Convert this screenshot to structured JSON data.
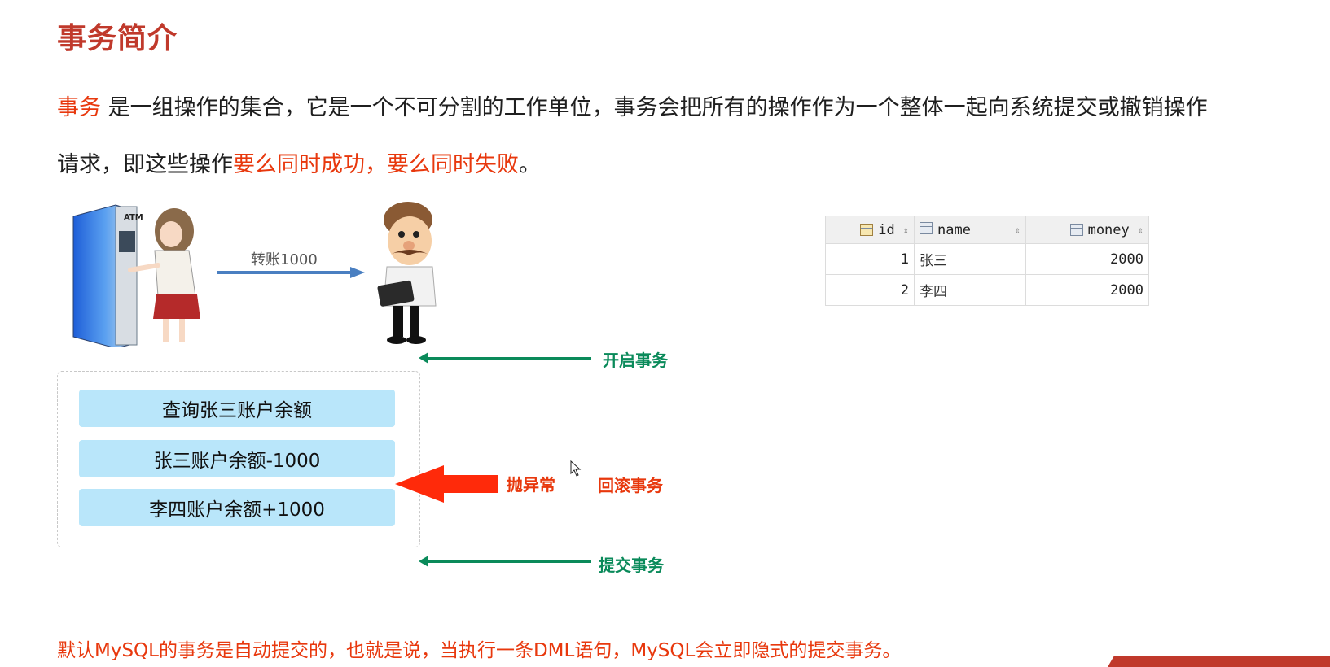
{
  "title": "事务简介",
  "intro": {
    "keyword": "事务",
    "line1_rest": " 是一组操作的集合，它是一个不可分割的工作单位，事务会把所有的操作作为一个整体一起向系统提交或撤销操作",
    "line2_prefix": "请求，即这些操作",
    "line2_highlight": "要么同时成功，要么同时失败",
    "line2_suffix": "。"
  },
  "illustration": {
    "atm_sign": "ATM",
    "transfer_label": "转账1000"
  },
  "table": {
    "columns": [
      "id",
      "name",
      "money"
    ],
    "rows": [
      {
        "id": "1",
        "name": "张三",
        "money": "2000"
      },
      {
        "id": "2",
        "name": "李四",
        "money": "2000"
      }
    ]
  },
  "steps": [
    "查询张三账户余额",
    "张三账户余额-1000",
    "李四账户余额+1000"
  ],
  "labels": {
    "begin": "开启事务",
    "exception": "抛异常",
    "rollback": "回滚事务",
    "commit": "提交事务"
  },
  "footer": "默认MySQL的事务是自动提交的，也就是说，当执行一条DML语句，MySQL会立即隐式的提交事务。",
  "colors": {
    "accent_red": "#e8380d",
    "title_red": "#c0392b",
    "green": "#0a8a5a",
    "step_fill": "#b9e6fa"
  }
}
